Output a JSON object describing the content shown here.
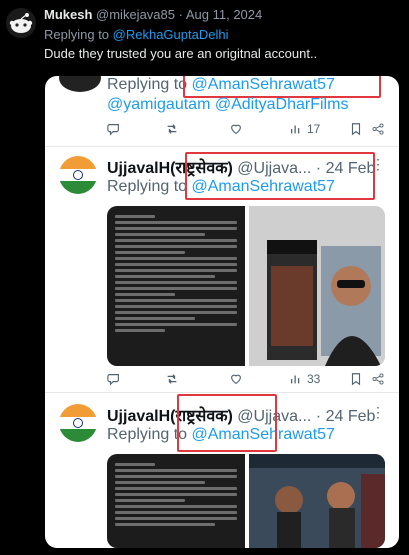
{
  "reply": {
    "name": "Mukesh",
    "handle": "@mikejava85",
    "separator": "·",
    "date": "Aug 11, 2024",
    "replying_prefix": "Replying to ",
    "replying_mention": "@RekhaGuptaDelhi",
    "text": "Dude they trusted you are an origitnal account.."
  },
  "screenshot": {
    "top_tweet": {
      "replying_prefix": "Replying to ",
      "replying_mention": "@AmanSehrawat57",
      "more_mentions": "@yamigautam @AdityaDharFilms",
      "views": "17"
    },
    "tweet1": {
      "name": "UjjavalH(राष्ट्रसेवक)",
      "handle": "@Ujjava...",
      "date": "· 24 Feb",
      "replying_prefix": "Replying to ",
      "replying_mention": "@AmanSehrawat57",
      "views": "33"
    },
    "tweet2": {
      "name": "UjjavalH(राष्ट्रसेवक)",
      "handle": "@Ujjava...",
      "date": "· 24 Feb",
      "replying_prefix": "Replying to ",
      "replying_mention": "@AmanSehrawat57"
    }
  },
  "colors": {
    "background": "#000000",
    "link": "#1d9bf0",
    "highlight_box": "#e0383e",
    "secondary_text": "#8b98a5"
  }
}
